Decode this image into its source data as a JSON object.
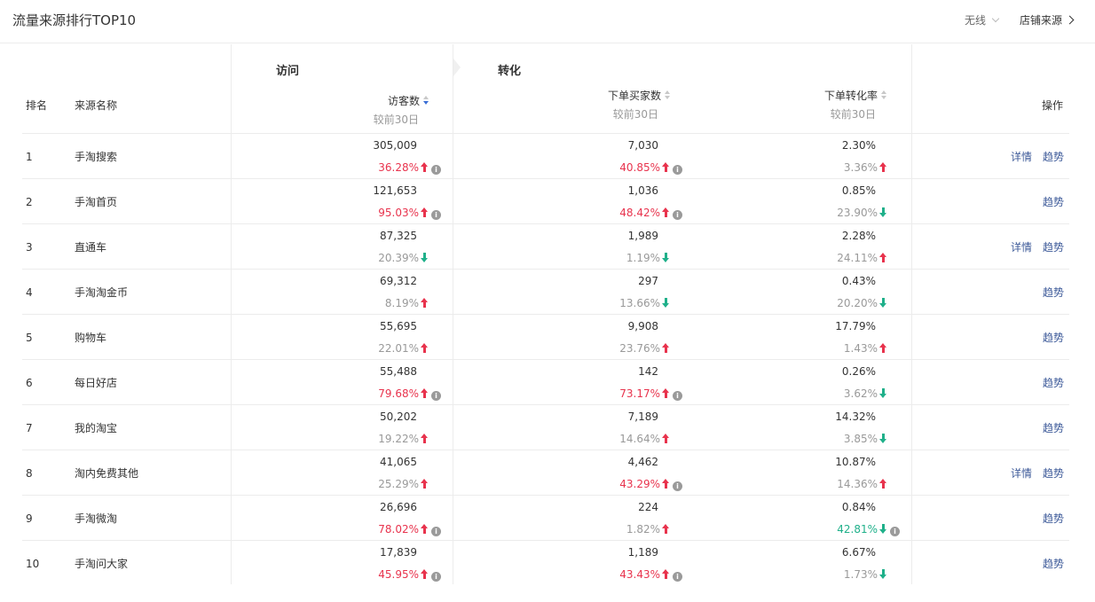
{
  "header": {
    "title": "流量来源排行TOP10",
    "filter_value": "无线",
    "source_link": "店铺来源"
  },
  "groups": {
    "visit": "访问",
    "conversion": "转化"
  },
  "columns": {
    "rank": "排名",
    "source": "来源名称",
    "visitors": "访客数",
    "buyers": "下单买家数",
    "rate": "下单转化率",
    "actions": "操作",
    "compare": "较前30日"
  },
  "actions": {
    "detail": "详情",
    "trend": "趋势"
  },
  "rows": [
    {
      "rank": "1",
      "name": "手淘搜索",
      "v": "305,009",
      "vc": "36.28%",
      "vd": "up",
      "vi": true,
      "vt": "red",
      "b": "7,030",
      "bc": "40.85%",
      "bd": "up",
      "bi": true,
      "bt": "red",
      "r": "2.30%",
      "rc": "3.36%",
      "rd": "up",
      "ri": false,
      "rt": "gray",
      "detail": true
    },
    {
      "rank": "2",
      "name": "手淘首页",
      "v": "121,653",
      "vc": "95.03%",
      "vd": "up",
      "vi": true,
      "vt": "red",
      "b": "1,036",
      "bc": "48.42%",
      "bd": "up",
      "bi": true,
      "bt": "red",
      "r": "0.85%",
      "rc": "23.90%",
      "rd": "down",
      "ri": false,
      "rt": "gray",
      "detail": false
    },
    {
      "rank": "3",
      "name": "直通车",
      "v": "87,325",
      "vc": "20.39%",
      "vd": "down",
      "vi": false,
      "vt": "gray",
      "b": "1,989",
      "bc": "1.19%",
      "bd": "down",
      "bi": false,
      "bt": "gray",
      "r": "2.28%",
      "rc": "24.11%",
      "rd": "up",
      "ri": false,
      "rt": "gray",
      "detail": true
    },
    {
      "rank": "4",
      "name": "手淘淘金币",
      "v": "69,312",
      "vc": "8.19%",
      "vd": "up",
      "vi": false,
      "vt": "gray",
      "b": "297",
      "bc": "13.66%",
      "bd": "down",
      "bi": false,
      "bt": "gray",
      "r": "0.43%",
      "rc": "20.20%",
      "rd": "down",
      "ri": false,
      "rt": "gray",
      "detail": false
    },
    {
      "rank": "5",
      "name": "购物车",
      "v": "55,695",
      "vc": "22.01%",
      "vd": "up",
      "vi": false,
      "vt": "gray",
      "b": "9,908",
      "bc": "23.76%",
      "bd": "up",
      "bi": false,
      "bt": "gray",
      "r": "17.79%",
      "rc": "1.43%",
      "rd": "up",
      "ri": false,
      "rt": "gray",
      "detail": false
    },
    {
      "rank": "6",
      "name": "每日好店",
      "v": "55,488",
      "vc": "79.68%",
      "vd": "up",
      "vi": true,
      "vt": "red",
      "b": "142",
      "bc": "73.17%",
      "bd": "up",
      "bi": true,
      "bt": "red",
      "r": "0.26%",
      "rc": "3.62%",
      "rd": "down",
      "ri": false,
      "rt": "gray",
      "detail": false
    },
    {
      "rank": "7",
      "name": "我的淘宝",
      "v": "50,202",
      "vc": "19.22%",
      "vd": "up",
      "vi": false,
      "vt": "gray",
      "b": "7,189",
      "bc": "14.64%",
      "bd": "up",
      "bi": false,
      "bt": "gray",
      "r": "14.32%",
      "rc": "3.85%",
      "rd": "down",
      "ri": false,
      "rt": "gray",
      "detail": false
    },
    {
      "rank": "8",
      "name": "淘内免费其他",
      "v": "41,065",
      "vc": "25.29%",
      "vd": "up",
      "vi": false,
      "vt": "gray",
      "b": "4,462",
      "bc": "43.29%",
      "bd": "up",
      "bi": true,
      "bt": "red",
      "r": "10.87%",
      "rc": "14.36%",
      "rd": "up",
      "ri": false,
      "rt": "gray",
      "detail": true
    },
    {
      "rank": "9",
      "name": "手淘微淘",
      "v": "26,696",
      "vc": "78.02%",
      "vd": "up",
      "vi": true,
      "vt": "red",
      "b": "224",
      "bc": "1.82%",
      "bd": "up",
      "bi": false,
      "bt": "gray",
      "r": "0.84%",
      "rc": "42.81%",
      "rd": "down",
      "ri": true,
      "rt": "green",
      "detail": false
    },
    {
      "rank": "10",
      "name": "手淘问大家",
      "v": "17,839",
      "vc": "45.95%",
      "vd": "up",
      "vi": true,
      "vt": "red",
      "b": "1,189",
      "bc": "43.43%",
      "bd": "up",
      "bi": true,
      "bt": "red",
      "r": "6.67%",
      "rc": "1.73%",
      "rd": "down",
      "ri": false,
      "rt": "gray",
      "detail": false
    }
  ],
  "info_glyph": "i",
  "colors": {
    "up": "#e8334d",
    "down": "#1fb08a",
    "link": "#3d5a99",
    "sort_active": "#3b6fd6"
  }
}
